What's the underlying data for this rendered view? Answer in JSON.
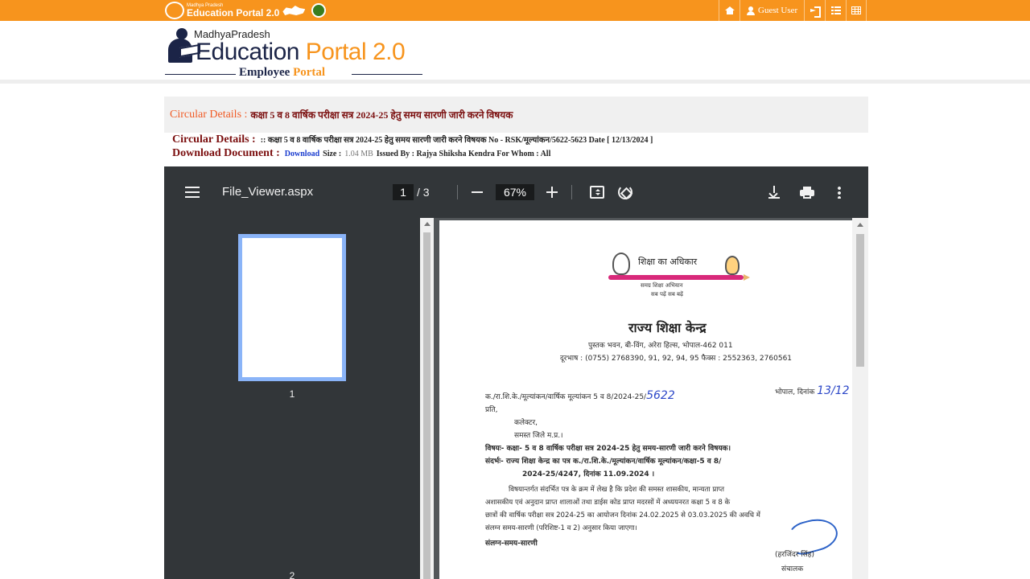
{
  "topbar": {
    "brand_small": "Madhya Pradesh",
    "brand_big": "Education Portal 2.0",
    "nav": {
      "home_icon": "home-icon",
      "user_label": "Guest User",
      "signin_icon": "sign-in-icon",
      "grid_icon": "list-icon",
      "table_icon": "table-icon"
    }
  },
  "logo": {
    "state": "MadhyaPradesh",
    "title_a": "Education",
    "title_b": " Portal 2.0",
    "subtitle_a": "Employee",
    "subtitle_b": " Portal"
  },
  "circular": {
    "title_label": "Circular Details :",
    "title_value": "कक्षा 5 व 8 वार्षिक परीक्षा सत्र 2024-25 हेतु समय सारणी जारी करने विषयक",
    "details_label": "Circular Details :",
    "details_text": ":: कक्षा 5 व 8 वार्षिक परीक्षा सत्र 2024-25 हेतु समय सारणी जारी करने विषयक No - RSK/मूल्यांकन/5622-5623 Date [ 12/13/2024 ]",
    "download_label": "Download Document :",
    "download_link": "Download",
    "size_label": "Size :",
    "size_value": "1.04 MB",
    "issued_text": "Issued By : Rajya Shiksha Kendra For Whom : All"
  },
  "viewer": {
    "file_name": "File_Viewer.aspx",
    "current_page": "1",
    "page_total": "/  3",
    "zoom": "67%",
    "thumbnails": [
      "1",
      "2"
    ]
  },
  "pdf_page": {
    "logo_title": "शिक्षा का अधिकार",
    "logo_sub1": "समग्र शिक्षा अभियान",
    "logo_sub2": "सब पढ़ें सब बढ़ें",
    "org": "राज्य शिक्षा केन्द्र",
    "address": "पुस्तक भवन, बी-विंग, अरेरा हिल्स, भोपाल-462 011",
    "phone": "दूरभाष : (0755) 2768390, 91, 92, 94, 95 फैक्स : 2552363, 2760561",
    "ref": "क./रा.शि.के./मूल्यांकन/वार्षिक मूल्यांकन 5 व 8/2024-25/",
    "ref_hand": "5622",
    "place": "भोपाल, दिनांक",
    "date_hand": "13/12",
    "prati": "प्रति,",
    "to1": "कलेक्टर,",
    "to2": "समस्त जिले म.प्र.।",
    "subject": "विषयः- कक्षा- 5 व 8 वार्षिक परीक्षा सत्र 2024-25 हेतु समय-सारणी जारी करने विषयक।",
    "reference1": "संदर्भः- राज्य शिक्षा केन्द्र का पत्र क./रा.शि.के./मूल्यांकन/वार्षिक मूल्यांकन/कक्षा-5 व 8/",
    "reference2": "2024-25/4247, दिनांक 11.09.2024 ।",
    "body1": "विषयान्तर्गत संदर्भित पत्र के क्रम में लेख है कि प्रदेश की समस्त शासकीय, मान्यता प्राप्त",
    "body2": "अशासकीय एवं अनुदान प्राप्त शालाओं तथा डाईस कोड प्राप्त मदरसों में अध्ययनरत कक्षा 5 व 8 के",
    "body3": "छात्रों की वार्षिक परीक्षा सत्र 2024-25 का आयोजन दिनांक 24.02.2025 से 03.03.2025 की अवधि में",
    "body4": "संलग्न समय-सारणी (परिशिष्ट-1 व 2) अनुसार किया जाएगा।",
    "attach": "संलग्न-समय-सारणी",
    "signer": "(हरजिंदर सिंह)",
    "designation": "संचालक"
  }
}
